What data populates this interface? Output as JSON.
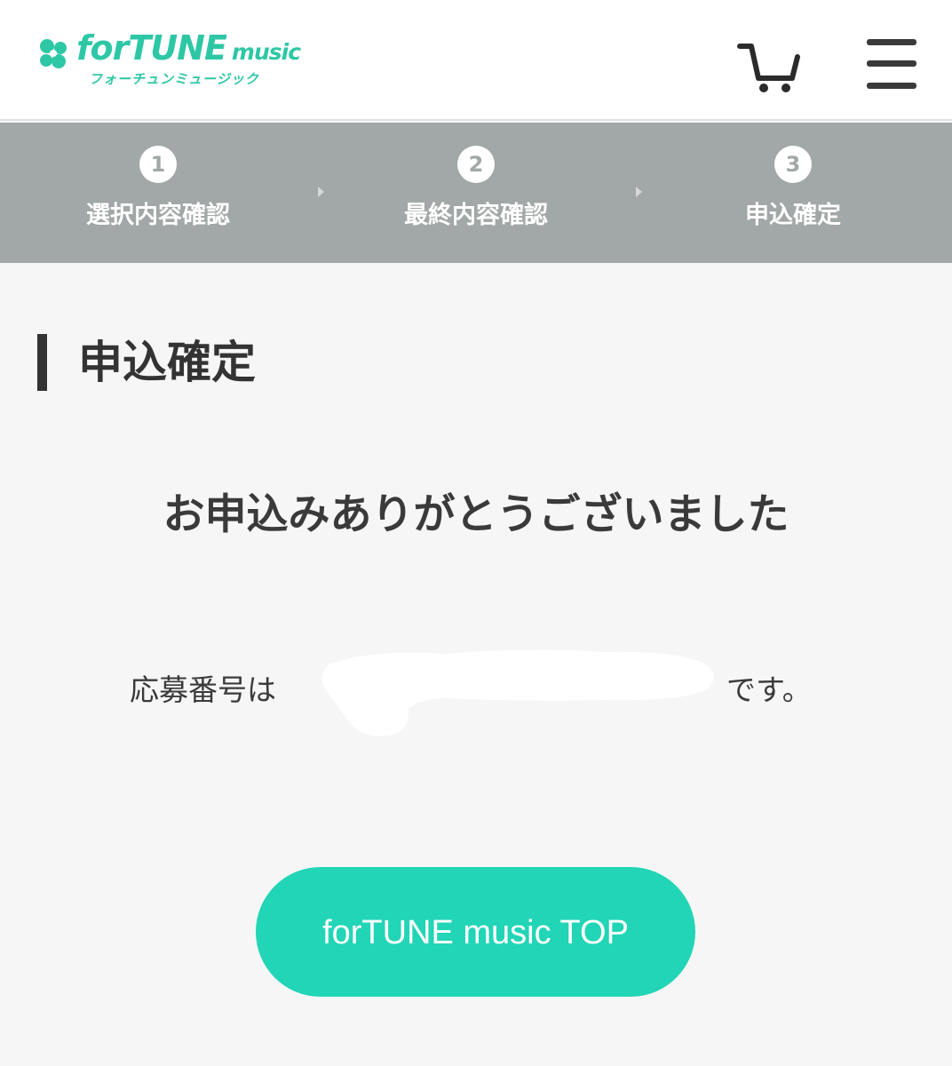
{
  "header": {
    "logo": {
      "wordmark_main": "forTUNE",
      "wordmark_sub": "music",
      "kana": "フォーチュンミュージック"
    },
    "cart_icon": "cart-icon",
    "menu_icon": "hamburger-menu-icon"
  },
  "steps": [
    {
      "number": "1",
      "label": "選択内容確認"
    },
    {
      "number": "2",
      "label": "最終内容確認"
    },
    {
      "number": "3",
      "label": "申込確定"
    }
  ],
  "main": {
    "title": "申込確定",
    "thanks_message": "お申込みありがとうございました",
    "application_number_prefix": "応募番号は",
    "application_number_suffix": "です。",
    "top_button_label": "forTUNE music TOP"
  },
  "colors": {
    "brand": "#2ec7a6",
    "button": "#22d5b6",
    "steps_bar": "#a2a8a7",
    "background": "#f6f6f6"
  }
}
